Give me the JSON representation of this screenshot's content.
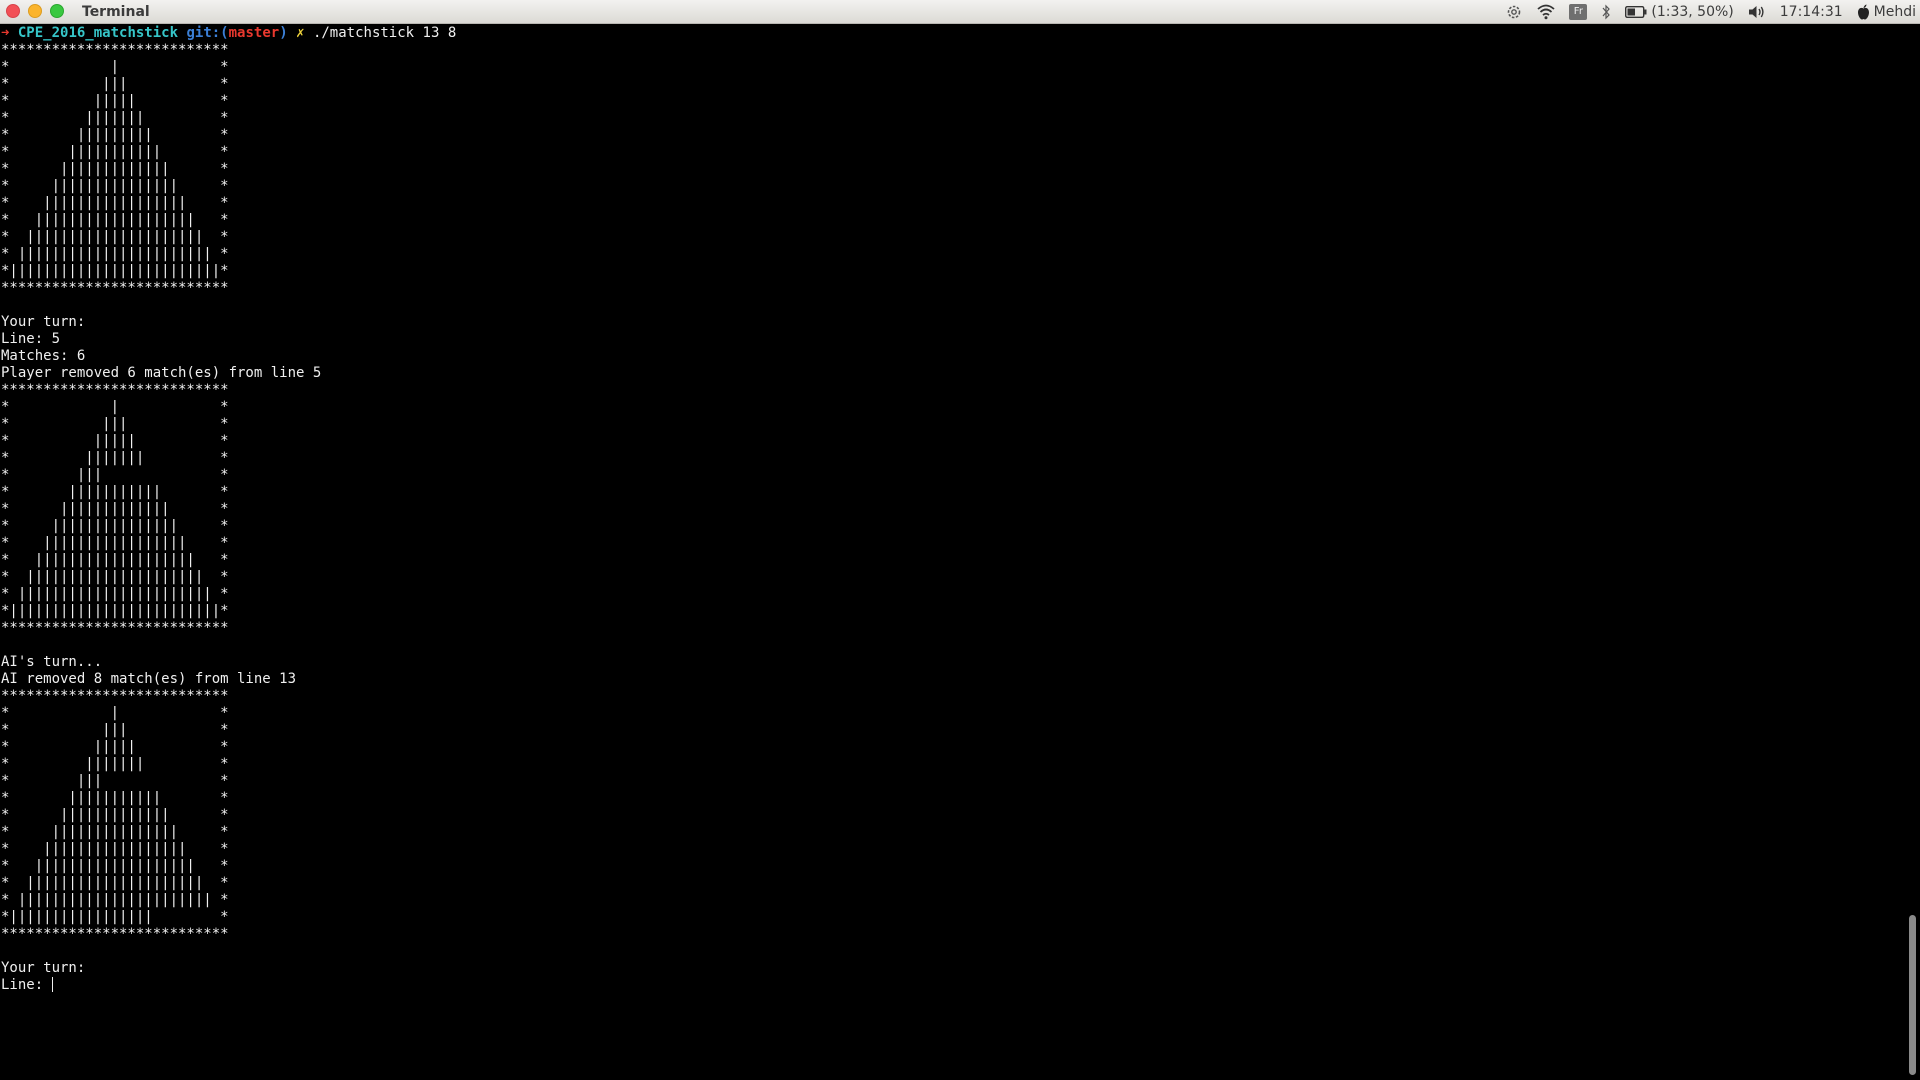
{
  "window": {
    "title": "Terminal",
    "buttons": [
      "close",
      "minimize",
      "maximize"
    ]
  },
  "tray": {
    "settings_icon": "gear-icon",
    "wifi_icon": "wifi-icon",
    "keyboard_layout": "Fr",
    "bluetooth_icon": "bluetooth-icon",
    "battery_text": "(1:33, 50%)",
    "volume_icon": "speaker-icon",
    "clock": "17:14:31",
    "user": "Mehdi"
  },
  "prompt": {
    "arrow": "➜",
    "directory": "CPE_2016_matchstick",
    "git_label": "git:(",
    "branch": "master",
    "git_close": ")",
    "dirty": "✗",
    "command": "./matchstick 13 8"
  },
  "output": "***************************\n*            |            *\n*           |||           *\n*          |||||          *\n*         |||||||         *\n*        |||||||||        *\n*       |||||||||||       *\n*      |||||||||||||      *\n*     |||||||||||||||     *\n*    |||||||||||||||||    *\n*   |||||||||||||||||||   *\n*  |||||||||||||||||||||  *\n* ||||||||||||||||||||||| *\n*|||||||||||||||||||||||||*\n***************************\n\nYour turn:\nLine: 5\nMatches: 6\nPlayer removed 6 match(es) from line 5\n***************************\n*            |            *\n*           |||           *\n*          |||||          *\n*         |||||||         *\n*        |||              *\n*       |||||||||||       *\n*      |||||||||||||      *\n*     |||||||||||||||     *\n*    |||||||||||||||||    *\n*   |||||||||||||||||||   *\n*  |||||||||||||||||||||  *\n* ||||||||||||||||||||||| *\n*|||||||||||||||||||||||||*\n***************************\n\nAI's turn...\nAI removed 8 match(es) from line 13\n***************************\n*            |            *\n*           |||           *\n*          |||||          *\n*         |||||||         *\n*        |||              *\n*       |||||||||||       *\n*      |||||||||||||      *\n*     |||||||||||||||     *\n*    |||||||||||||||||    *\n*   |||||||||||||||||||   *\n*  |||||||||||||||||||||  *\n* ||||||||||||||||||||||| *\n*|||||||||||||||||        *\n***************************\n\nYour turn:",
  "input": {
    "label": "Line: ",
    "value": ""
  },
  "colors": {
    "background": "#000000",
    "foreground": "#f0f0f0",
    "prompt_arrow": "#e8382e",
    "prompt_dir": "#36c5c8",
    "prompt_git": "#3b7fd6",
    "prompt_branch": "#e8382e",
    "prompt_dirty": "#f0d43c"
  }
}
